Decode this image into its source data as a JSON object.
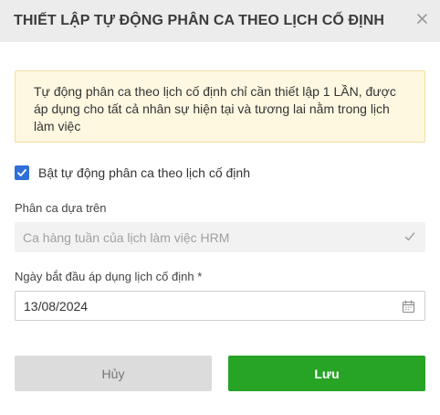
{
  "dialog": {
    "title": "THIẾT LẬP TỰ ĐỘNG PHÂN CA THEO LỊCH CỐ ĐỊNH",
    "close_icon": "close-icon"
  },
  "notice": {
    "text": "Tự động phân ca theo lịch cố định chỉ cần thiết lập 1 LẦN, được áp dụng cho tất cả nhân sự hiện tại và tương lai nằm trong lịch làm việc"
  },
  "auto_assign": {
    "checked": true,
    "label": "Bật tự động phân ca theo lịch cố định"
  },
  "shift_basis": {
    "label": "Phân ca dựa trên",
    "value": "Ca hàng tuần của lịch làm việc HRM",
    "disabled": true
  },
  "start_date": {
    "label": "Ngày bắt đầu áp dụng lịch cố định *",
    "value": "13/08/2024",
    "icon": "calendar-icon"
  },
  "actions": {
    "cancel_label": "Hủy",
    "save_label": "Lưu"
  },
  "colors": {
    "primary_check": "#2f6fd6",
    "save_green": "#27a326",
    "notice_bg": "#fff8e1",
    "notice_border": "#f3dfa0",
    "header_bg": "#ececec"
  }
}
